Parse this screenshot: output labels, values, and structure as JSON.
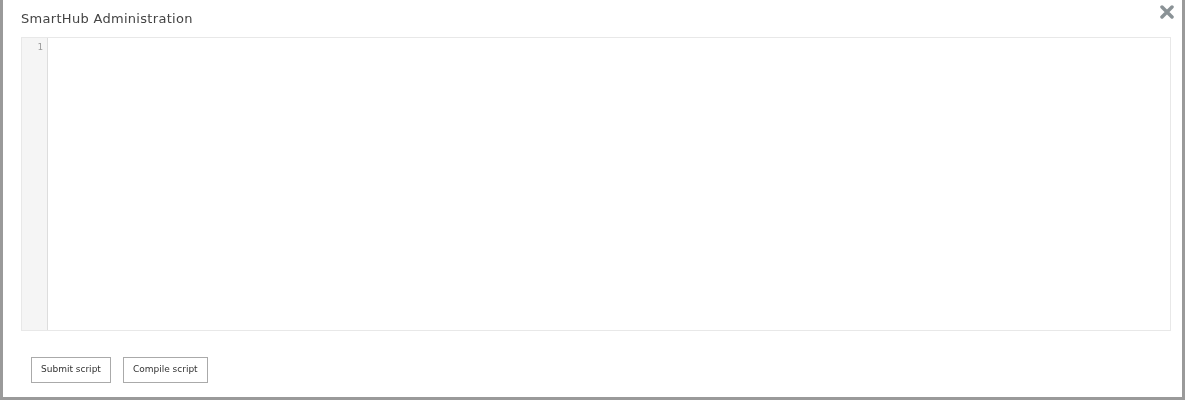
{
  "window": {
    "title": "SmartHub Administration"
  },
  "editor": {
    "line_numbers": [
      "1"
    ]
  },
  "buttons": [
    {
      "label": "Submit script"
    },
    {
      "label": "Compile script"
    }
  ]
}
